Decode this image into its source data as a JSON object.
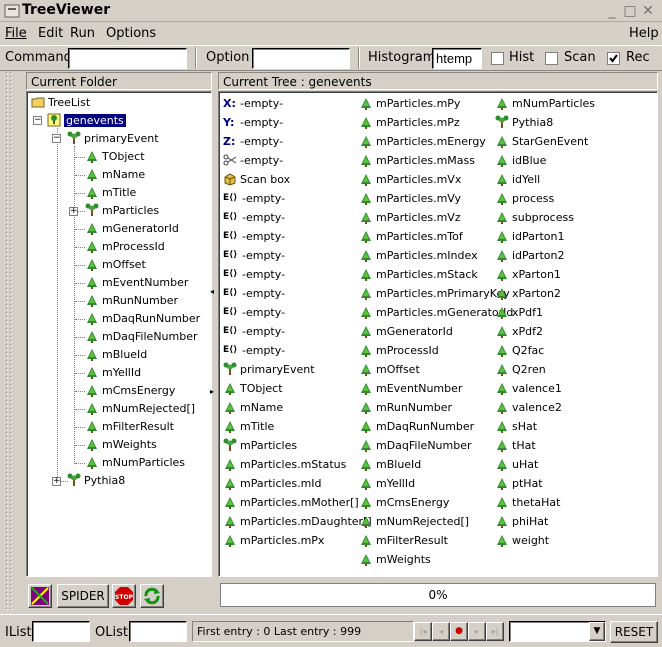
{
  "window": {
    "title": "TreeViewer"
  },
  "menu": {
    "file": "File",
    "edit": "Edit",
    "run": "Run",
    "options": "Options",
    "help": "Help"
  },
  "toolbar": {
    "command_label": "Command",
    "command_value": "",
    "option_label": "Option",
    "option_value": "",
    "histogram_label": "Histogram",
    "histogram_value": "htemp",
    "hist_label": "Hist",
    "hist_checked": false,
    "scan_label": "Scan",
    "scan_checked": false,
    "rec_label": "Rec",
    "rec_checked": true
  },
  "left_panel": {
    "title": "Current Folder",
    "root": "TreeList",
    "selected": "genevents",
    "primary": "primaryEvent",
    "children": [
      "TObject",
      "mName",
      "mTitle",
      "mParticles",
      "mGeneratorId",
      "mProcessId",
      "mOffset",
      "mEventNumber",
      "mRunNumber",
      "mDaqRunNumber",
      "mDaqFileNumber",
      "mBlueId",
      "mYellId",
      "mCmsEnergy",
      "mNumRejected[]",
      "mFilterResult",
      "mWeights",
      "mNumParticles"
    ],
    "pythia": "Pythia8"
  },
  "right_panel": {
    "title": "Current Tree : genevents",
    "col1": [
      {
        "icon": "X:",
        "label": "-empty-"
      },
      {
        "icon": "Y:",
        "label": "-empty-"
      },
      {
        "icon": "Z:",
        "label": "-empty-"
      },
      {
        "icon": "scissors",
        "label": "-empty-"
      },
      {
        "icon": "box",
        "label": "Scan box"
      },
      {
        "icon": "E()",
        "label": "-empty-"
      },
      {
        "icon": "E()",
        "label": "-empty-"
      },
      {
        "icon": "E()",
        "label": "-empty-"
      },
      {
        "icon": "E()",
        "label": "-empty-"
      },
      {
        "icon": "E()",
        "label": "-empty-"
      },
      {
        "icon": "E()",
        "label": "-empty-"
      },
      {
        "icon": "E()",
        "label": "-empty-"
      },
      {
        "icon": "E()",
        "label": "-empty-"
      },
      {
        "icon": "E()",
        "label": "-empty-"
      },
      {
        "icon": "branch",
        "label": "primaryEvent"
      },
      {
        "icon": "leaf",
        "label": "TObject"
      },
      {
        "icon": "leaf",
        "label": "mName"
      },
      {
        "icon": "leaf",
        "label": "mTitle"
      },
      {
        "icon": "branch",
        "label": "mParticles"
      },
      {
        "icon": "leaf",
        "label": "mParticles.mStatus"
      },
      {
        "icon": "leaf",
        "label": "mParticles.mId"
      },
      {
        "icon": "leaf",
        "label": "mParticles.mMother[]"
      },
      {
        "icon": "leaf",
        "label": "mParticles.mDaughter[]"
      },
      {
        "icon": "leaf",
        "label": "mParticles.mPx"
      }
    ],
    "col2": [
      "mParticles.mPy",
      "mParticles.mPz",
      "mParticles.mEnergy",
      "mParticles.mMass",
      "mParticles.mVx",
      "mParticles.mVy",
      "mParticles.mVz",
      "mParticles.mTof",
      "mParticles.mIndex",
      "mParticles.mStack",
      "mParticles.mPrimaryKey",
      "mParticles.mGeneratorId",
      "mGeneratorId",
      "mProcessId",
      "mOffset",
      "mEventNumber",
      "mRunNumber",
      "mDaqRunNumber",
      "mDaqFileNumber",
      "mBlueId",
      "mYellId",
      "mCmsEnergy",
      "mNumRejected[]",
      "mFilterResult",
      "mWeights"
    ],
    "col3": [
      {
        "icon": "leaf",
        "label": "mNumParticles"
      },
      {
        "icon": "branch",
        "label": "Pythia8"
      },
      {
        "icon": "leaf",
        "label": "StarGenEvent"
      },
      {
        "icon": "leaf",
        "label": "idBlue"
      },
      {
        "icon": "leaf",
        "label": "idYell"
      },
      {
        "icon": "leaf",
        "label": "process"
      },
      {
        "icon": "leaf",
        "label": "subprocess"
      },
      {
        "icon": "leaf",
        "label": "idParton1"
      },
      {
        "icon": "leaf",
        "label": "idParton2"
      },
      {
        "icon": "leaf",
        "label": "xParton1"
      },
      {
        "icon": "leaf",
        "label": "xParton2"
      },
      {
        "icon": "leaf",
        "label": "xPdf1"
      },
      {
        "icon": "leaf",
        "label": "xPdf2"
      },
      {
        "icon": "leaf",
        "label": "Q2fac"
      },
      {
        "icon": "leaf",
        "label": "Q2ren"
      },
      {
        "icon": "leaf",
        "label": "valence1"
      },
      {
        "icon": "leaf",
        "label": "valence2"
      },
      {
        "icon": "leaf",
        "label": "sHat"
      },
      {
        "icon": "leaf",
        "label": "tHat"
      },
      {
        "icon": "leaf",
        "label": "uHat"
      },
      {
        "icon": "leaf",
        "label": "ptHat"
      },
      {
        "icon": "leaf",
        "label": "thetaHat"
      },
      {
        "icon": "leaf",
        "label": "phiHat"
      },
      {
        "icon": "leaf",
        "label": "weight"
      }
    ],
    "progress": "0%",
    "progress_value": 0
  },
  "bottom_buttons": {
    "spider": "SPIDER",
    "stop": "STOP"
  },
  "statusbar": {
    "ilist_label": "IList",
    "ilist_value": "",
    "olist_label": "OList",
    "olist_value": "",
    "entries": "First entry : 0 Last entry : 999",
    "reset": "RESET"
  }
}
